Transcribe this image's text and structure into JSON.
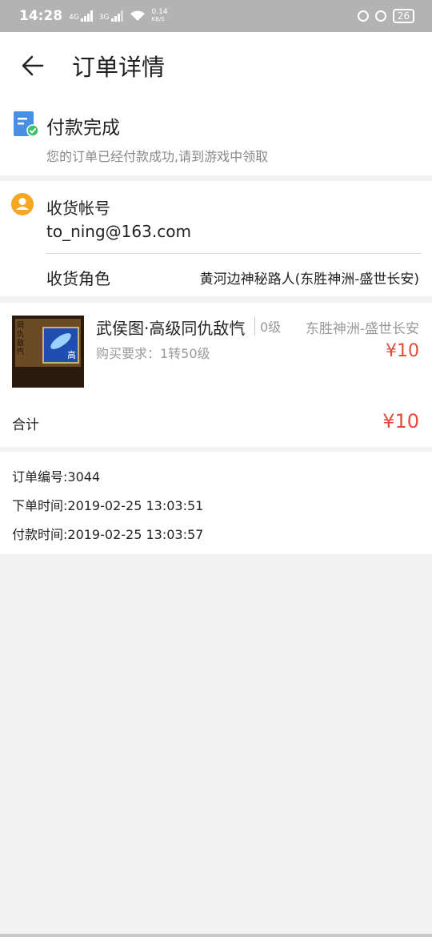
{
  "status_bar": {
    "time": "14:28",
    "net1": "4G",
    "net2": "3G",
    "speed_value": "0.14",
    "speed_unit": "KB/S",
    "battery": "26"
  },
  "header": {
    "title": "订单详情"
  },
  "order_status": {
    "title": "付款完成",
    "description": "您的订单已经付款成功,请到游戏中领取"
  },
  "receiver": {
    "account_label": "收货帐号",
    "account_value": "to_ning@163.com",
    "role_label": "收货角色",
    "role_value": "黄河边神秘路人(东胜神洲-盛世长安)"
  },
  "item": {
    "name": "武侯图·高级同仇敌忾",
    "level": "0级",
    "server": "东胜神洲-盛世长安",
    "requirement": "购买要求：1转50级",
    "price": "¥10",
    "thumb_badge": "高",
    "thumb_text": "同仇敌忾"
  },
  "total": {
    "label": "合计",
    "value": "¥10"
  },
  "order_info": {
    "number": "订单编号:3044",
    "order_time": "下单时间:2019-02-25 13:03:51",
    "pay_time": "付款时间:2019-02-25 13:03:57"
  },
  "colors": {
    "price_red": "#e14b3b",
    "status_blue": "#4a90e2",
    "status_green": "#3dbf6e",
    "user_orange": "#f5a623"
  }
}
